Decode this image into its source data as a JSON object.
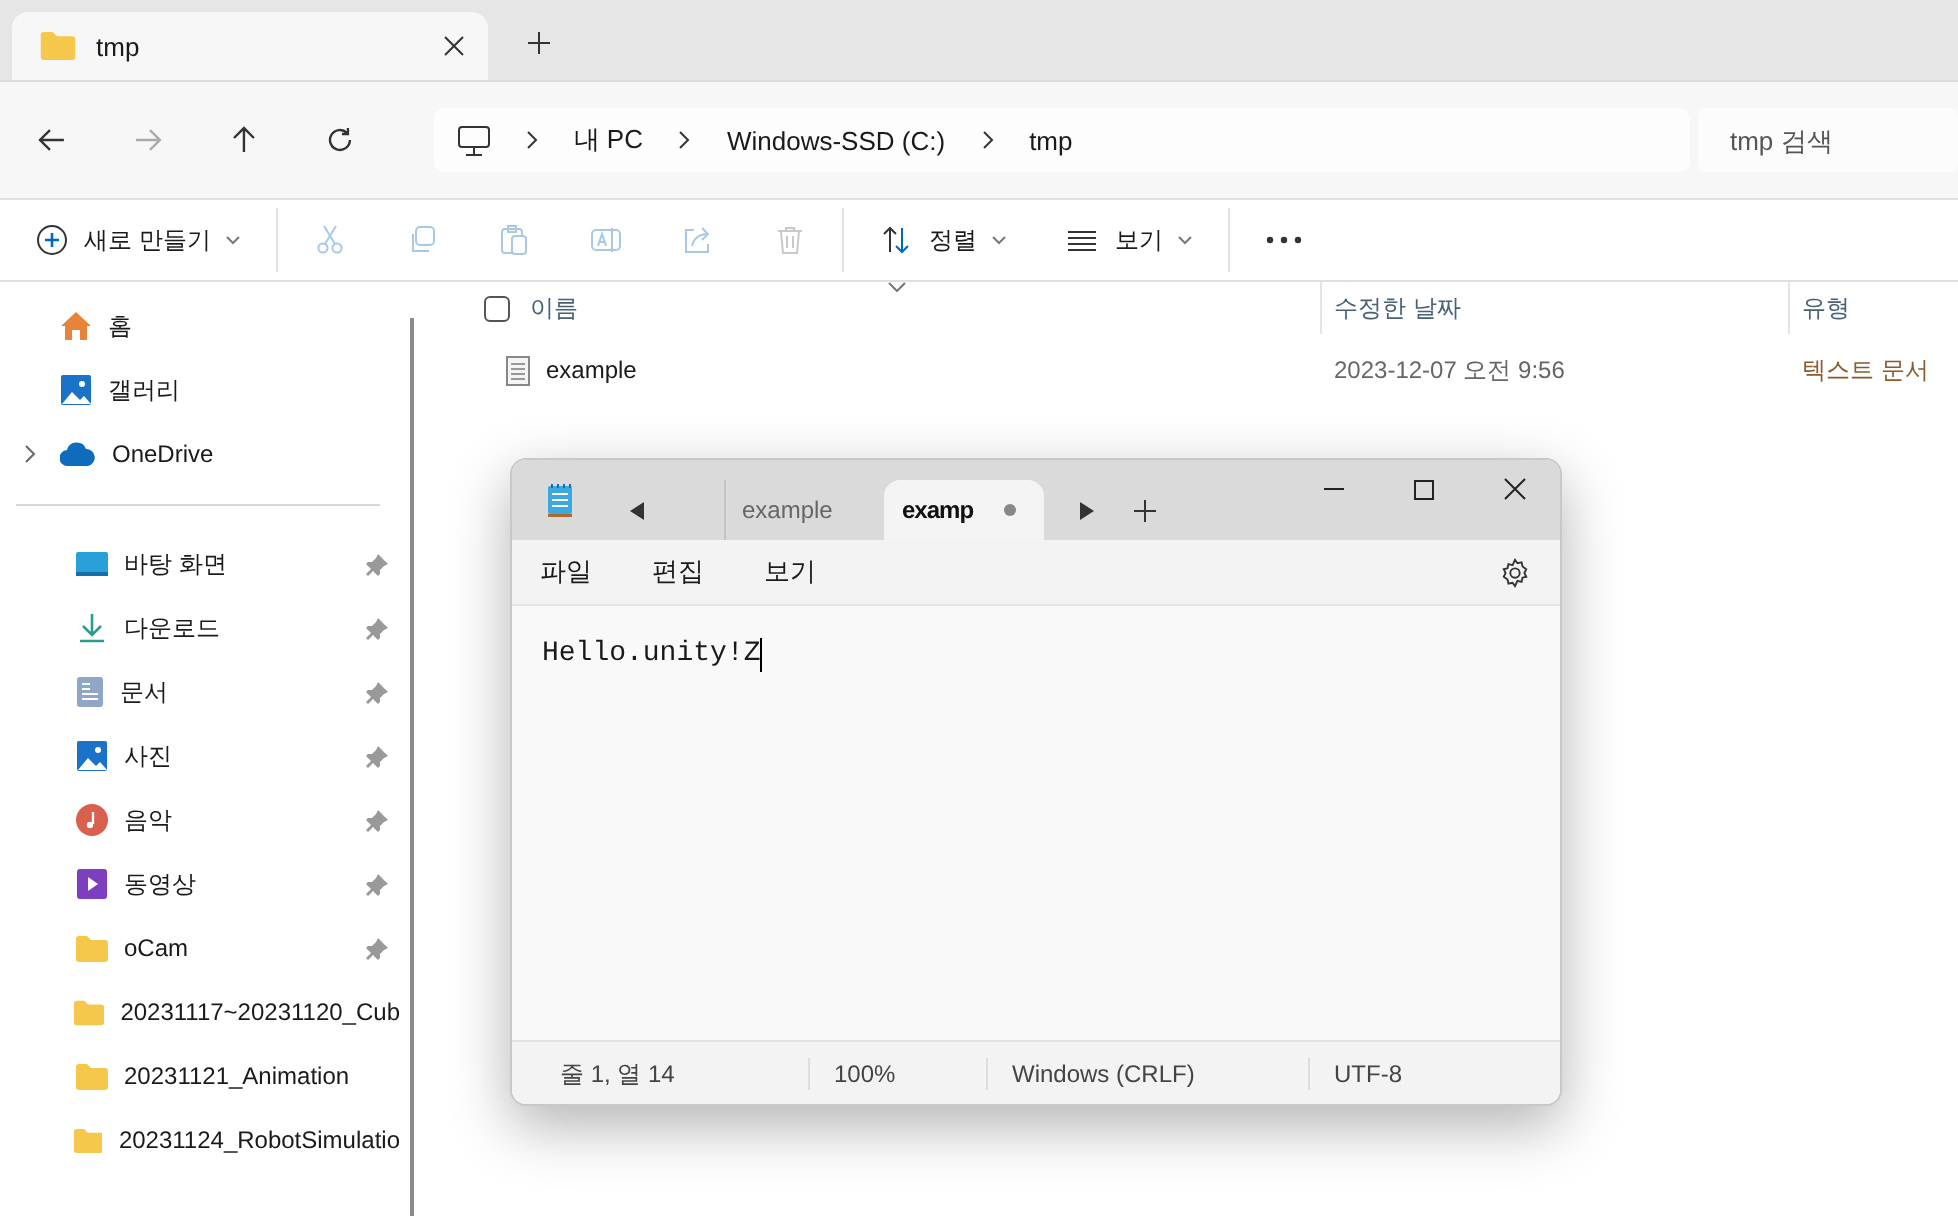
{
  "explorer": {
    "tabs": [
      {
        "label": "tmp",
        "selected": true
      }
    ],
    "breadcrumbs": [
      "내 PC",
      "Windows-SSD (C:)",
      "tmp"
    ],
    "search": {
      "placeholder": "tmp 검색"
    },
    "toolbar": [
      {
        "kind": "new",
        "label": "새로 만들기",
        "disabled": false
      },
      {
        "kind": "cut",
        "disabled": true
      },
      {
        "kind": "copy",
        "disabled": true
      },
      {
        "kind": "paste",
        "disabled": true
      },
      {
        "kind": "rename",
        "disabled": true
      },
      {
        "kind": "share",
        "disabled": true
      },
      {
        "kind": "delete",
        "disabled": true
      },
      {
        "kind": "sort",
        "label": "정렬",
        "disabled": false
      },
      {
        "kind": "view",
        "label": "보기",
        "disabled": false
      },
      {
        "kind": "more",
        "disabled": false
      }
    ],
    "sidebar": {
      "top": [
        {
          "kind": "home",
          "label": "홈"
        },
        {
          "kind": "gallery",
          "label": "갤러리"
        },
        {
          "kind": "cloud",
          "label": "OneDrive",
          "expanded": false
        }
      ],
      "pinned": [
        {
          "kind": "desktop",
          "label": "바탕 화면",
          "pinned": true
        },
        {
          "kind": "download",
          "label": "다운로드",
          "pinned": true
        },
        {
          "kind": "document",
          "label": "문서",
          "pinned": true
        },
        {
          "kind": "picture",
          "label": "사진",
          "pinned": true
        },
        {
          "kind": "music",
          "label": "음악",
          "pinned": true
        },
        {
          "kind": "video",
          "label": "동영상",
          "pinned": true
        },
        {
          "kind": "folder",
          "label": "oCam",
          "pinned": true
        },
        {
          "kind": "folder",
          "label": "20231117~20231120_Cub",
          "pinned": false
        },
        {
          "kind": "folder",
          "label": "20231121_Animation",
          "pinned": false
        },
        {
          "kind": "folder",
          "label": "20231124_RobotSimulatio",
          "pinned": false
        }
      ]
    },
    "table": {
      "select_all": {
        "checked": false
      },
      "columns": [
        "이름",
        "수정한 날짜",
        "유형"
      ],
      "rows": [
        {
          "name": "example",
          "modified": "2023-12-07 오전 9:56",
          "type": "텍스트 문서",
          "selected": false
        }
      ]
    }
  },
  "notepad": {
    "tabs": [
      {
        "label": "example",
        "selected": false,
        "unsaved": false
      },
      {
        "label": "examp",
        "selected": true,
        "unsaved": true
      }
    ],
    "menu": [
      "파일",
      "편집",
      "보기"
    ],
    "text": "Hello.unity!Z",
    "status_bar": [
      "줄 1, 열 14",
      "100%",
      "Windows (CRLF)",
      "UTF-8"
    ]
  }
}
